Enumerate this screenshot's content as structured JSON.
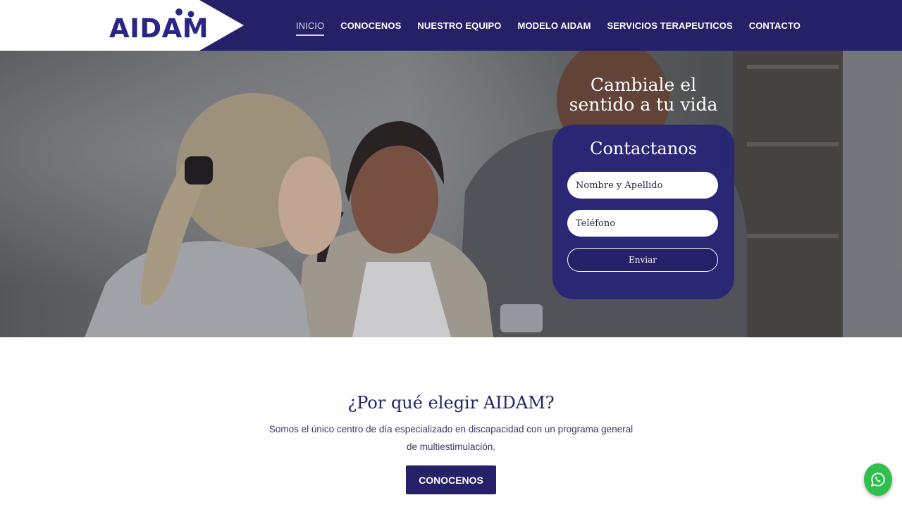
{
  "brand": {
    "logo_text": "AIDAM"
  },
  "nav": {
    "items": [
      {
        "label": "INICIO",
        "active": true
      },
      {
        "label": "CONOCENOS",
        "active": false
      },
      {
        "label": "NUESTRO EQUIPO",
        "active": false
      },
      {
        "label": "MODELO AIDAM",
        "active": false
      },
      {
        "label": "SERVICIOS TERAPEUTICOS",
        "active": false
      },
      {
        "label": "CONTACTO",
        "active": false
      }
    ]
  },
  "hero": {
    "title": "Cambiale el sentido a tu vida",
    "form": {
      "title": "Contactanos",
      "name_placeholder": "Nombre y Apellido",
      "phone_placeholder": "Teléfono",
      "submit_label": "Enviar"
    }
  },
  "why": {
    "title": "¿Por qué elegir AIDAM?",
    "description": "Somos el único centro de día especializado en discapacidad con un programa general de multiestimulación.",
    "button_label": "CONOCENOS"
  },
  "whatsapp": {
    "icon": "whatsapp-icon"
  },
  "colors": {
    "primary": "#242168",
    "accent_text": "#2b2684",
    "whatsapp": "#2fbf4d"
  }
}
